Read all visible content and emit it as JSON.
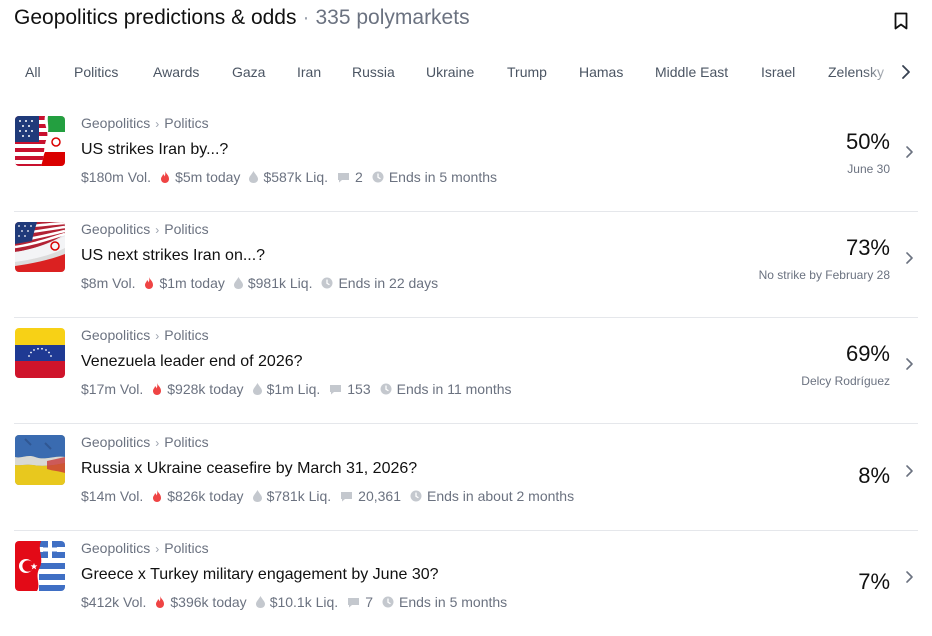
{
  "header": {
    "title": "Geopolitics predictions & odds",
    "separator": "·",
    "count": "335 polymarkets",
    "bookmark_icon": "bookmark-icon"
  },
  "tabs": [
    "All",
    "Politics",
    "Awards",
    "Gaza",
    "Iran",
    "Russia",
    "Ukraine",
    "Trump",
    "Hamas",
    "Middle East",
    "Israel",
    "Zelensky"
  ],
  "colors": {
    "text": "#111111",
    "muted": "#6b7280",
    "fire": "#ef4444",
    "divider": "#e5e7eb"
  },
  "markets": [
    {
      "flag": "usa-iran-flag",
      "category": "Geopolitics",
      "subcategory": "Politics",
      "title": "US strikes Iran by...?",
      "volume": "$180m Vol.",
      "today": "$5m today",
      "liquidity": "$587k Liq.",
      "comments": "2",
      "ends": "Ends in 5 months",
      "percent": "50%",
      "outcome": "June 30"
    },
    {
      "flag": "usa-iran-flag",
      "category": "Geopolitics",
      "subcategory": "Politics",
      "title": "US next strikes Iran on...?",
      "volume": "$8m Vol.",
      "today": "$1m today",
      "liquidity": "$981k Liq.",
      "comments": "",
      "ends": "Ends in 22 days",
      "percent": "73%",
      "outcome": "No strike by February 28"
    },
    {
      "flag": "venezuela-flag",
      "category": "Geopolitics",
      "subcategory": "Politics",
      "title": "Venezuela leader end of 2026?",
      "volume": "$17m Vol.",
      "today": "$928k today",
      "liquidity": "$1m Liq.",
      "comments": "153",
      "ends": "Ends in 11 months",
      "percent": "69%",
      "outcome": "Delcy Rodríguez"
    },
    {
      "flag": "russia-ukraine-flag",
      "category": "Geopolitics",
      "subcategory": "Politics",
      "title": "Russia x Ukraine ceasefire by March 31, 2026?",
      "volume": "$14m Vol.",
      "today": "$826k today",
      "liquidity": "$781k Liq.",
      "comments": "20,361",
      "ends": "Ends in about 2 months",
      "percent": "8%",
      "outcome": ""
    },
    {
      "flag": "turkey-greece-flag",
      "category": "Geopolitics",
      "subcategory": "Politics",
      "title": "Greece x Turkey military engagement by June 30?",
      "volume": "$412k Vol.",
      "today": "$396k today",
      "liquidity": "$10.1k Liq.",
      "comments": "7",
      "ends": "Ends in 5 months",
      "percent": "7%",
      "outcome": ""
    }
  ]
}
